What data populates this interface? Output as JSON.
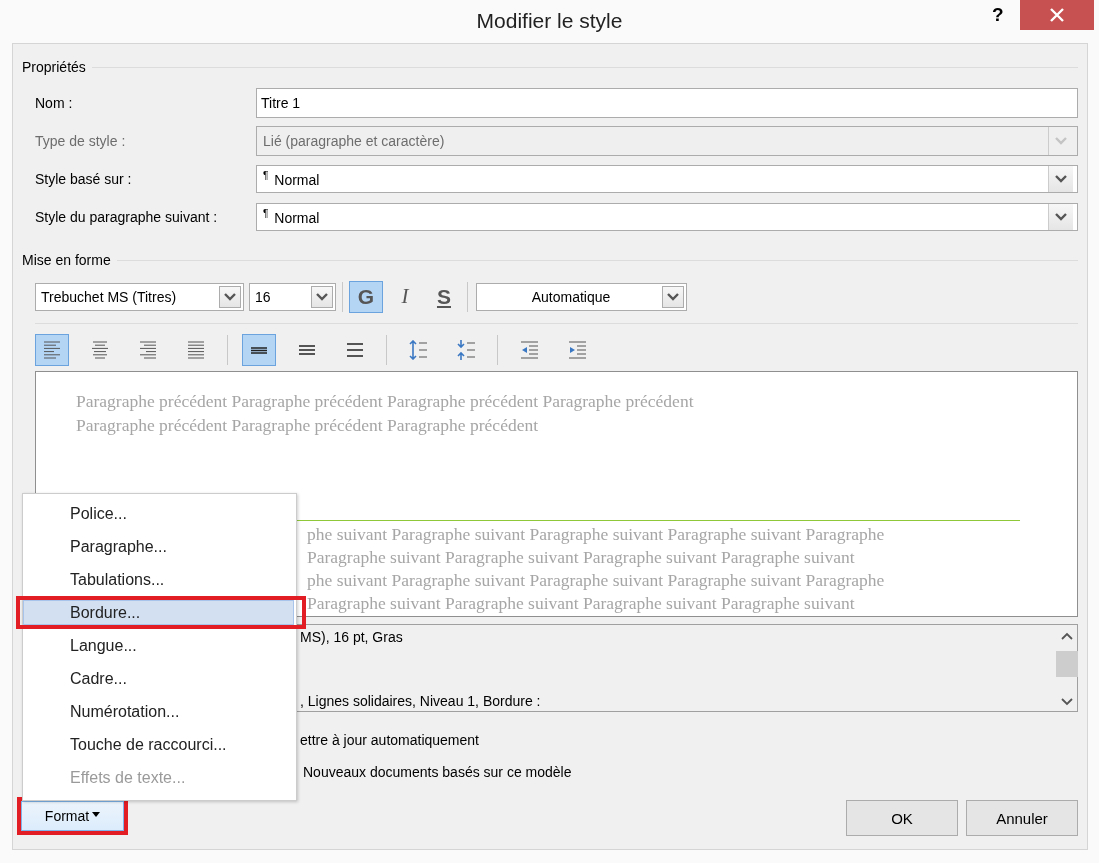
{
  "window": {
    "title": "Modifier le style",
    "help": "?"
  },
  "properties": {
    "heading": "Propriétés",
    "fields": [
      {
        "label": "Nom :",
        "kind": "text",
        "value": "Titre 1",
        "disabled": false
      },
      {
        "label": "Type de style :",
        "kind": "dropdown",
        "value": "Lié (paragraphe et caractère)",
        "disabled": true
      },
      {
        "label": "Style basé sur :",
        "kind": "dropdown",
        "value": "$^{¶}$ Normal",
        "disabled": false
      },
      {
        "label": "Style du paragraphe suivant :",
        "kind": "dropdown",
        "value": "$^{¶}$ Normal",
        "disabled": false
      }
    ]
  },
  "formatting": {
    "heading": "Mise en forme",
    "font": "Trebuchet MS (Titres)",
    "size": "16",
    "text_color": "Automatique",
    "style_buttons": [
      {
        "kind": "bold",
        "label": "G",
        "selected": true
      },
      {
        "kind": "italic",
        "label": "I",
        "selected": false
      },
      {
        "kind": "underline",
        "label": "S",
        "selected": false
      }
    ],
    "paragraph_groups": [
      [
        {
          "kind": "align-left",
          "selected": true
        },
        {
          "kind": "align-center",
          "selected": false
        },
        {
          "kind": "align-right",
          "selected": false
        },
        {
          "kind": "justify",
          "selected": false
        }
      ],
      [
        {
          "kind": "spacing-single",
          "selected": true
        },
        {
          "kind": "spacing-onehalf",
          "selected": false
        },
        {
          "kind": "spacing-double",
          "selected": false
        }
      ],
      [
        {
          "kind": "space-increase",
          "selected": false
        },
        {
          "kind": "space-decrease",
          "selected": false
        }
      ],
      [
        {
          "kind": "indent-decrease",
          "selected": false
        },
        {
          "kind": "indent-increase",
          "selected": false
        }
      ]
    ]
  },
  "preview": {
    "preceding_lines": [
      "Paragraphe précédent Paragraphe précédent Paragraphe précédent Paragraphe précédent",
      "Paragraphe précédent Paragraphe précédent Paragraphe précédent"
    ],
    "following_lines": [
      "phe suivant Paragraphe suivant Paragraphe suivant Paragraphe suivant Paragraphe",
      "Paragraphe suivant Paragraphe suivant Paragraphe suivant Paragraphe suivant",
      "phe suivant Paragraphe suivant Paragraphe suivant Paragraphe suivant Paragraphe",
      "Paragraphe suivant Paragraphe suivant Paragraphe suivant Paragraphe suivant"
    ]
  },
  "description": {
    "first_line": "MS), 16 pt, Gras",
    "last_line": ", Lignes solidaires, Niveau 1, Bordure :"
  },
  "options": {
    "checkbox_label": "ettre à jour automatiquement",
    "radio_label": "Nouveaux documents basés sur ce modèle"
  },
  "buttons": [
    "OK",
    "Annuler"
  ],
  "format_button": {
    "label": "Format",
    "annotated": true
  },
  "format_menu": [
    {
      "label": "Police...",
      "disabled": false,
      "selected": false,
      "annotated": false
    },
    {
      "label": "Paragraphe...",
      "disabled": false,
      "selected": false,
      "annotated": false
    },
    {
      "label": "Tabulations...",
      "disabled": false,
      "selected": false,
      "annotated": false
    },
    {
      "label": "Bordure...",
      "disabled": false,
      "selected": true,
      "annotated": true
    },
    {
      "label": "Langue...",
      "disabled": false,
      "selected": false,
      "annotated": false
    },
    {
      "label": "Cadre...",
      "disabled": false,
      "selected": false,
      "annotated": false
    },
    {
      "label": "Numérotation...",
      "disabled": false,
      "selected": false,
      "annotated": false
    },
    {
      "label": "Touche de raccourci...",
      "disabled": false,
      "selected": false,
      "annotated": false
    },
    {
      "label": "Effets de texte...",
      "disabled": true,
      "selected": false,
      "annotated": false
    }
  ]
}
